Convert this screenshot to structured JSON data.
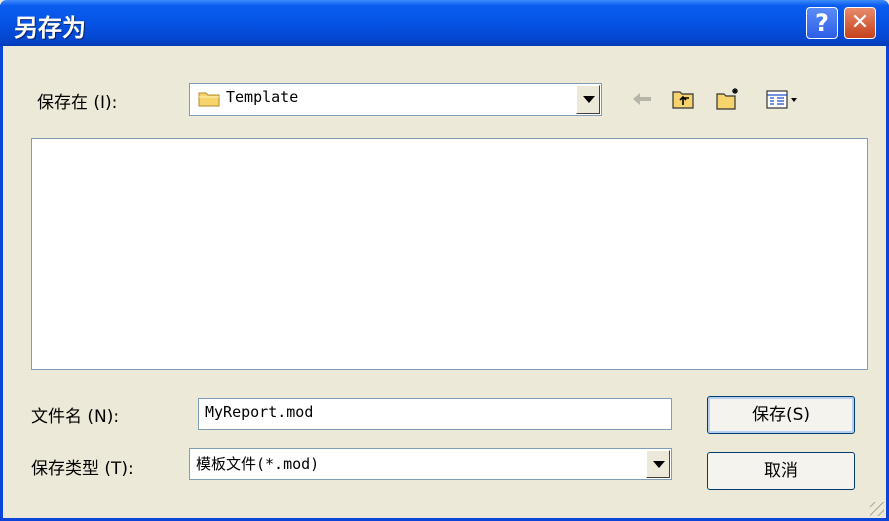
{
  "window": {
    "title": "另存为"
  },
  "titlebar": {
    "help_label": "?",
    "close_label": "✕"
  },
  "save_in": {
    "label": "保存在 (I):",
    "value": "Template"
  },
  "toolbar": {
    "back": "arrow-left-icon",
    "up": "up-folder-icon",
    "new_folder": "new-folder-icon",
    "views": "view-menu-icon"
  },
  "filename": {
    "label": "文件名 (N):",
    "value": "MyReport.mod"
  },
  "filetype": {
    "label": "保存类型 (T):",
    "value": "模板文件(*.mod)"
  },
  "buttons": {
    "save": "保存(S)",
    "cancel": "取消"
  },
  "colors": {
    "title_bar": "#0553e4",
    "dialog_bg": "#ece9d8",
    "folder": "#f6d36b"
  }
}
